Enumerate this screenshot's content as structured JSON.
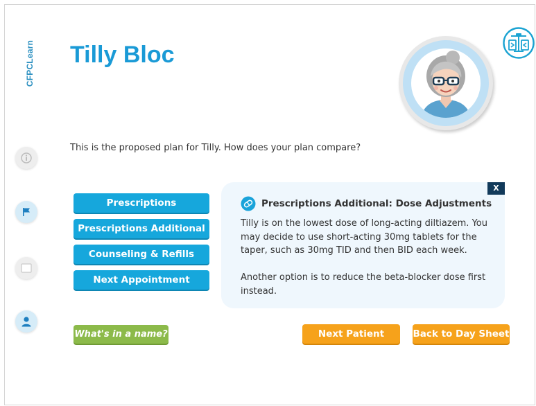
{
  "brand": {
    "name": "CFPCLearn"
  },
  "patient": {
    "name": "Tilly Bloc"
  },
  "prompt": "This is the proposed plan for Tilly. How does your plan compare?",
  "menu": [
    {
      "label": "Prescriptions"
    },
    {
      "label": "Prescriptions Additional"
    },
    {
      "label": "Counseling & Refills"
    },
    {
      "label": "Next Appointment"
    }
  ],
  "panel": {
    "close_label": "X",
    "title": "Prescriptions Additional: Dose Adjustments",
    "paragraphs": [
      "Tilly is on the lowest dose of long-acting diltiazem. You may decide to use short-acting 30mg tablets for the taper, such as 30mg TID and then BID each week.",
      "Another option is to reduce the beta-blocker dose first instead."
    ]
  },
  "buttons": {
    "whats_in_name": "What's in a name?",
    "next_patient": "Next Patient",
    "back_to_day_sheet": "Back to Day Sheet"
  },
  "colors": {
    "primary_blue": "#16a7dc",
    "title_blue": "#1a9ad6",
    "orange": "#f6a21b",
    "green": "#8cba4a",
    "dark_navy": "#123a5a",
    "panel_bg": "#eff7fd"
  },
  "icons": {
    "rail": [
      "info-icon",
      "flag-icon",
      "notes-icon",
      "user-icon"
    ],
    "header": "scale-icon",
    "panel": "pills-icon"
  }
}
